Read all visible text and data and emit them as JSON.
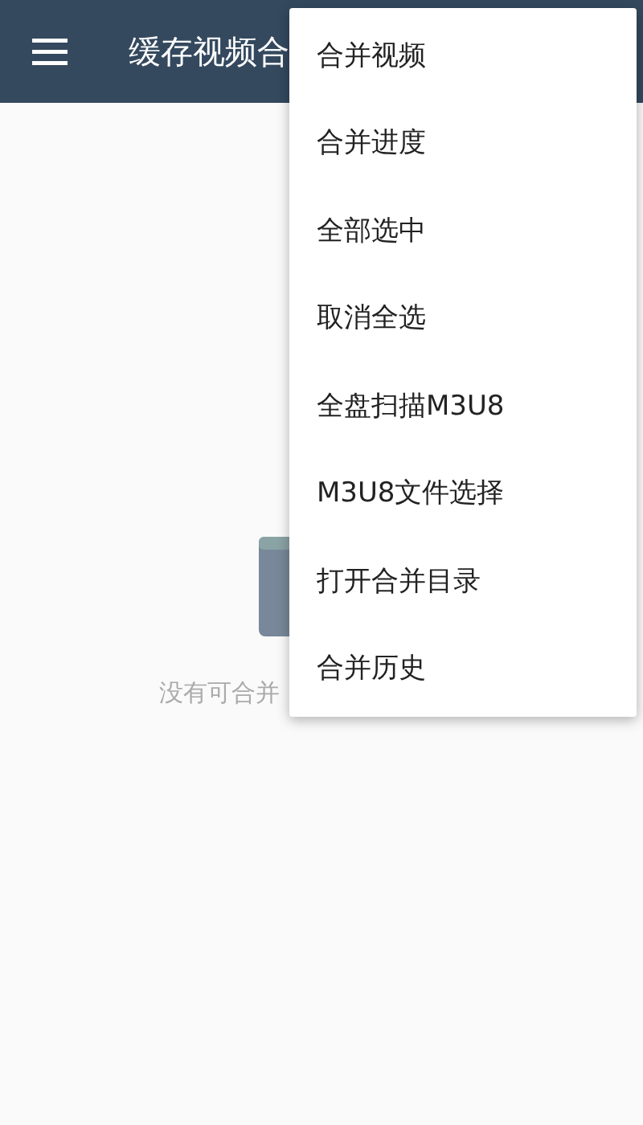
{
  "app_bar": {
    "title": "缓存视频合"
  },
  "empty_state": {
    "message": "没有可合并"
  },
  "menu": {
    "items": [
      {
        "label": "合并视频"
      },
      {
        "label": "合并进度"
      },
      {
        "label": "全部选中"
      },
      {
        "label": "取消全选"
      },
      {
        "label": "全盘扫描M3U8"
      },
      {
        "label": "M3U8文件选择"
      },
      {
        "label": "打开合并目录"
      },
      {
        "label": "合并历史"
      }
    ]
  }
}
